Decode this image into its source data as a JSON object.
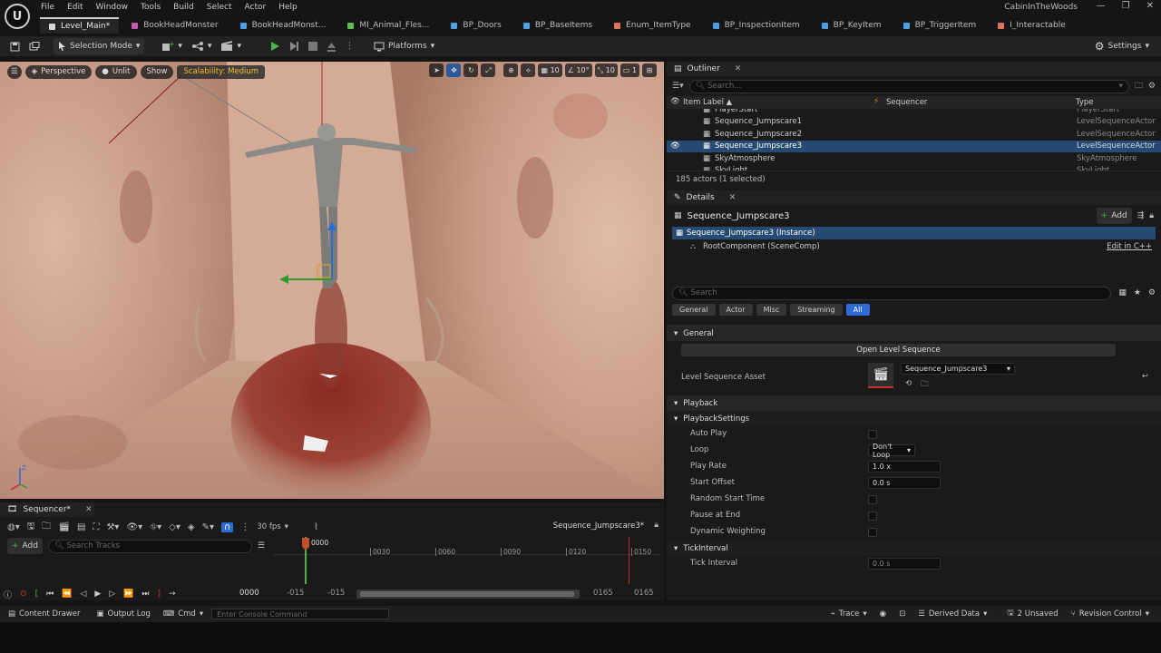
{
  "app": {
    "logo": "U",
    "project_name": "CabinInTheWoods"
  },
  "menu": [
    "File",
    "Edit",
    "Window",
    "Tools",
    "Build",
    "Select",
    "Actor",
    "Help"
  ],
  "window_controls": [
    "—",
    "❐",
    "✕"
  ],
  "tabs": [
    {
      "label": "Level_Main*",
      "color": "#d8d8d8",
      "active": true
    },
    {
      "label": "BookHeadMonster",
      "color": "#c65aa8"
    },
    {
      "label": "BookHeadMonst...",
      "color": "#4aa0e0"
    },
    {
      "label": "MI_Animal_Fles...",
      "color": "#5bbf4a"
    },
    {
      "label": "BP_Doors",
      "color": "#4aa0e0"
    },
    {
      "label": "BP_BaseItems",
      "color": "#4aa0e0"
    },
    {
      "label": "Enum_ItemType",
      "color": "#e07060"
    },
    {
      "label": "BP_InspectionItem",
      "color": "#4aa0e0"
    },
    {
      "label": "BP_KeyItem",
      "color": "#4aa0e0"
    },
    {
      "label": "BP_TriggerItem",
      "color": "#4aa0e0"
    },
    {
      "label": "I_Interactable",
      "color": "#e07060"
    }
  ],
  "toolbar": {
    "selection_mode": "Selection Mode",
    "platforms": "Platforms",
    "settings": "Settings"
  },
  "viewport": {
    "perspective": "Perspective",
    "unlit": "Unlit",
    "show": "Show",
    "scalability": "Scalability: Medium",
    "grid_value": "10",
    "angle_value": "10°",
    "scale_value": "10",
    "camera_value": "1"
  },
  "outliner": {
    "title": "Outliner",
    "search_placeholder": "Search...",
    "col_label": "Item Label",
    "col_sequencer": "Sequencer",
    "col_type": "Type",
    "rows": [
      {
        "label": "PlayerStart",
        "type": "PlayerStart"
      },
      {
        "label": "Sequence_Jumpscare1",
        "type": "LevelSequenceActor"
      },
      {
        "label": "Sequence_Jumpscare2",
        "type": "LevelSequenceActor"
      },
      {
        "label": "Sequence_Jumpscare3",
        "type": "LevelSequenceActor",
        "selected": true
      },
      {
        "label": "SkyAtmosphere",
        "type": "SkyAtmosphere"
      },
      {
        "label": "SkyLight",
        "type": "SkyLight"
      }
    ],
    "footer": "185 actors (1 selected)"
  },
  "details": {
    "title": "Details",
    "actor_name": "Sequence_Jumpscare3",
    "add_label": "Add",
    "instance": "Sequence_Jumpscare3 (Instance)",
    "root_component": "RootComponent (SceneComp)",
    "edit_cpp": "Edit in C++",
    "search_placeholder": "Search",
    "filters": [
      "General",
      "Actor",
      "Misc",
      "Streaming",
      "All"
    ],
    "section_general": "General",
    "open_level_sequence": "Open Level Sequence",
    "level_sequence_asset_label": "Level Sequence Asset",
    "level_sequence_asset_value": "Sequence_Jumpscare3",
    "section_playback": "Playback",
    "section_playback_settings": "PlaybackSettings",
    "auto_play": "Auto Play",
    "loop": "Loop",
    "loop_value": "Don't Loop",
    "play_rate": "Play Rate",
    "play_rate_value": "1.0 x",
    "start_offset": "Start Offset",
    "start_offset_value": "0.0 s",
    "random_start_time": "Random Start Time",
    "pause_at_end": "Pause at End",
    "dynamic_weighting": "Dynamic Weighting",
    "section_tick_interval": "TickInterval",
    "tick_interval": "Tick Interval",
    "tick_interval_value": "0.0 s"
  },
  "sequencer": {
    "tab": "Sequencer*",
    "add_label": "Add",
    "search_placeholder": "Search Tracks",
    "fps": "30 fps",
    "sequence_name": "Sequence_Jumpscare3*",
    "playhead_frame": "0000",
    "ticks": [
      "0030",
      "0060",
      "0090",
      "0120",
      "0150"
    ],
    "current_frame": "0000",
    "range_start_a": "-015",
    "range_start_b": "-015",
    "range_end_a": "0165",
    "range_end_b": "0165"
  },
  "statusbar": {
    "content_drawer": "Content Drawer",
    "output_log": "Output Log",
    "cmd": "Cmd",
    "console_placeholder": "Enter Console Command",
    "trace": "Trace",
    "derived_data": "Derived Data",
    "unsaved": "2 Unsaved",
    "revision_control": "Revision Control"
  }
}
